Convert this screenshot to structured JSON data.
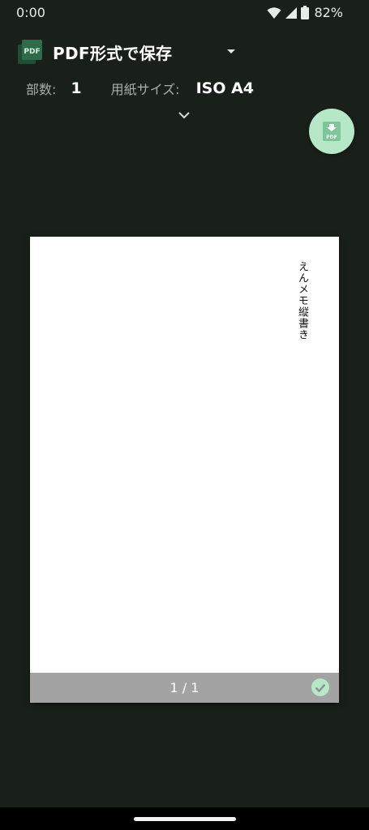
{
  "status_bar": {
    "time": "0:00",
    "battery_percent": "82%",
    "icons": [
      "wifi-icon",
      "cell-signal-icon",
      "battery-icon"
    ]
  },
  "header": {
    "printer_icon": "pdf-icon",
    "printer_name": "PDF形式で保存",
    "copies_label": "部数:",
    "copies_value": "1",
    "paper_size_label": "用紙サイズ:",
    "paper_size_value": "ISO A4"
  },
  "fab": {
    "icon": "pdf-download-icon",
    "icon_text": "PDF"
  },
  "page": {
    "content_text": "えんメモ縦書き",
    "page_number": "1 / 1",
    "selected": true
  },
  "colors": {
    "background": "#192019",
    "fab": "#b6e8c8",
    "pdf_icon": "#2e6b4a",
    "page_footer": "#a3a3a3",
    "check": "#b6e8c8"
  }
}
